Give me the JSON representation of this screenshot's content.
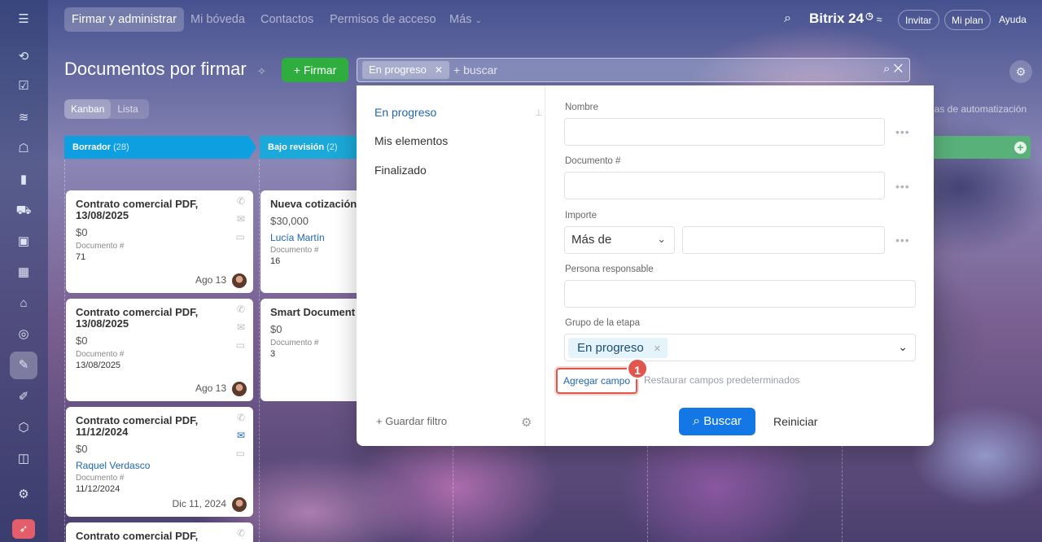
{
  "nav": {
    "items": [
      "Firmar y administrar",
      "Mi bóveda",
      "Contactos",
      "Permisos de acceso",
      "Más"
    ],
    "brand": "Bitrix 24",
    "invite": "Invitar",
    "plan": "Mi plan",
    "help": "Ayuda"
  },
  "page": {
    "title": "Documentos por firmar",
    "sign_button": "+ Firmar",
    "views": [
      "Kanban",
      "Lista"
    ],
    "automation": "las de automatización"
  },
  "columns": [
    {
      "name": "Borrador",
      "count": "(28)"
    },
    {
      "name": "Bajo revisión",
      "count": "(2)"
    }
  ],
  "cards_col1": [
    {
      "title": "Contrato comercial PDF, 13/08/2025",
      "amount": "$0",
      "person": "",
      "doc_label": "Documento #",
      "doc_num": "71",
      "date": "Ago 13"
    },
    {
      "title": "Contrato comercial PDF, 13/08/2025",
      "amount": "$0",
      "person": "",
      "doc_label": "Documento #",
      "doc_num": "13/08/2025",
      "date": "Ago 13"
    },
    {
      "title": "Contrato comercial PDF, 11/12/2024",
      "amount": "$0",
      "person": "Raquel Verdasco",
      "doc_label": "Documento #",
      "doc_num": "11/12/2024",
      "date": "Dic 11, 2024"
    },
    {
      "title": "Contrato comercial PDF,",
      "amount": "",
      "person": "",
      "doc_label": "",
      "doc_num": "",
      "date": ""
    }
  ],
  "cards_col2": [
    {
      "title": "Nueva cotización",
      "amount": "$30,000",
      "person": "Lucía Martín",
      "doc_label": "Documento #",
      "doc_num": "16"
    },
    {
      "title": "Smart Document #",
      "amount": "$0",
      "person": "",
      "doc_label": "Documento #",
      "doc_num": "3"
    }
  ],
  "search": {
    "tag": "En progreso",
    "placeholder": "+ buscar"
  },
  "filter": {
    "presets": [
      "En progreso",
      "Mis elementos",
      "Finalizado"
    ],
    "save_filter": "+ Guardar filtro",
    "fields": {
      "name": "Nombre",
      "doc": "Documento #",
      "amount": "Importe",
      "amount_op": "Más de",
      "responsible": "Persona responsable",
      "stage_group": "Grupo de la etapa",
      "stage_value": "En progreso"
    },
    "add_field": "Agregar campo",
    "restore": "Restaurar campos predeterminados",
    "badge": "1",
    "search_button": "Buscar",
    "reset_button": "Reiniciar"
  }
}
